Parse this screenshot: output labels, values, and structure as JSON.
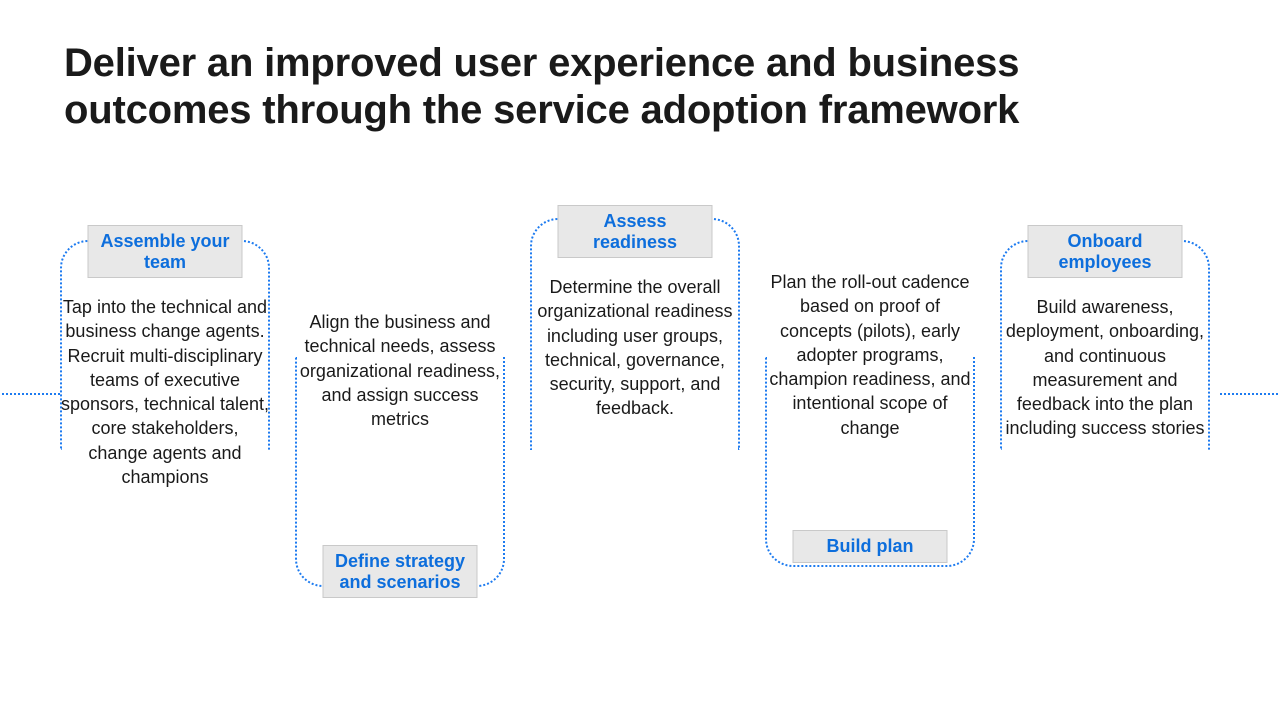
{
  "title": "Deliver an improved user experience and business outcomes through the service adoption framework",
  "steps": {
    "s1": {
      "label": "Assemble your team",
      "body": "Tap into the technical and business change agents. Recruit multi-disciplinary teams of executive sponsors, technical talent, core stakeholders, change agents and champions"
    },
    "s2": {
      "label": "Define strategy and scenarios",
      "body": "Align the business and technical needs, assess organizational readiness, and assign success metrics"
    },
    "s3": {
      "label": "Assess readiness",
      "body": "Determine the overall organizational readiness including user groups, technical, governance, security, support, and feedback."
    },
    "s4": {
      "label": "Build plan",
      "body": "Plan the roll-out cadence based on proof of concepts (pilots), early adopter programs, champion readiness, and intentional scope of change"
    },
    "s5": {
      "label": "Onboard employees",
      "body": "Build awareness, deployment, onboarding, and continuous measurement and feedback into the plan including success stories"
    }
  }
}
